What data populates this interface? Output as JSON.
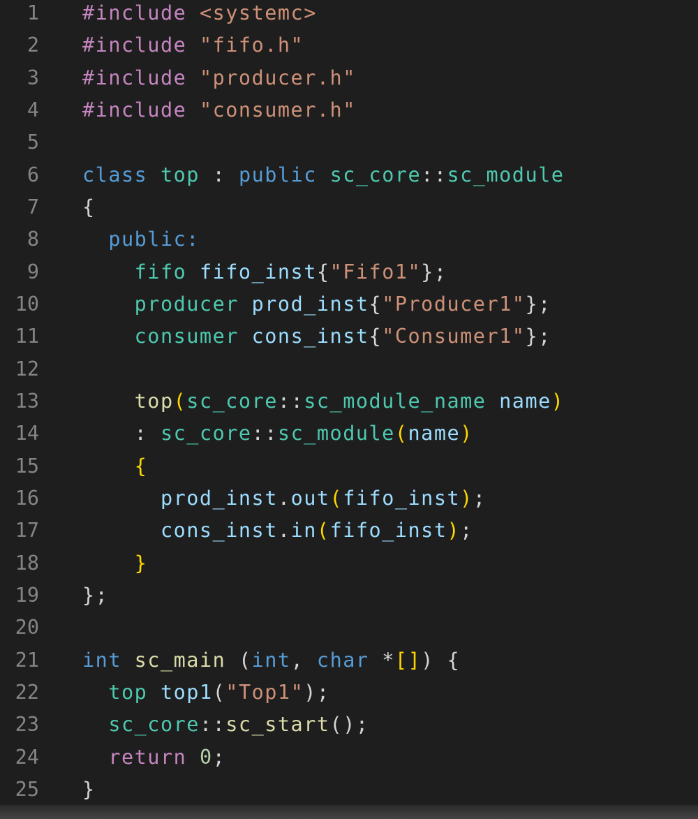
{
  "editor": {
    "language": "cpp",
    "lines": [
      {
        "n": "1",
        "tokens": [
          {
            "t": "#include",
            "c": "kwc"
          },
          {
            "t": " "
          },
          {
            "t": "<systemc>",
            "c": "str"
          }
        ]
      },
      {
        "n": "2",
        "tokens": [
          {
            "t": "#include",
            "c": "kwc"
          },
          {
            "t": " "
          },
          {
            "t": "\"fifo.h\"",
            "c": "str"
          }
        ]
      },
      {
        "n": "3",
        "tokens": [
          {
            "t": "#include",
            "c": "kwc"
          },
          {
            "t": " "
          },
          {
            "t": "\"producer.h\"",
            "c": "str"
          }
        ]
      },
      {
        "n": "4",
        "tokens": [
          {
            "t": "#include",
            "c": "kwc"
          },
          {
            "t": " "
          },
          {
            "t": "\"consumer.h\"",
            "c": "str"
          }
        ]
      },
      {
        "n": "5",
        "tokens": []
      },
      {
        "n": "6",
        "tokens": [
          {
            "t": "class",
            "c": "kw"
          },
          {
            "t": " "
          },
          {
            "t": "top",
            "c": "type"
          },
          {
            "t": " : ",
            "c": "punc"
          },
          {
            "t": "public",
            "c": "kw"
          },
          {
            "t": " "
          },
          {
            "t": "sc_core",
            "c": "type"
          },
          {
            "t": "::",
            "c": "punc"
          },
          {
            "t": "sc_module",
            "c": "type"
          }
        ]
      },
      {
        "n": "7",
        "tokens": [
          {
            "t": "{",
            "c": "punc"
          }
        ]
      },
      {
        "n": "8",
        "tokens": [
          {
            "t": "  "
          },
          {
            "t": "public",
            "c": "kw"
          },
          {
            "t": ":",
            "c": "kw"
          }
        ]
      },
      {
        "n": "9",
        "tokens": [
          {
            "t": "    "
          },
          {
            "t": "fifo",
            "c": "type"
          },
          {
            "t": " "
          },
          {
            "t": "fifo_inst",
            "c": "var"
          },
          {
            "t": "{",
            "c": "punc"
          },
          {
            "t": "\"Fifo1\"",
            "c": "str"
          },
          {
            "t": "};",
            "c": "punc"
          }
        ]
      },
      {
        "n": "10",
        "tokens": [
          {
            "t": "    "
          },
          {
            "t": "producer",
            "c": "type"
          },
          {
            "t": " "
          },
          {
            "t": "prod_inst",
            "c": "var"
          },
          {
            "t": "{",
            "c": "punc"
          },
          {
            "t": "\"Producer1\"",
            "c": "str"
          },
          {
            "t": "};",
            "c": "punc"
          }
        ]
      },
      {
        "n": "11",
        "tokens": [
          {
            "t": "    "
          },
          {
            "t": "consumer",
            "c": "type"
          },
          {
            "t": " "
          },
          {
            "t": "cons_inst",
            "c": "var"
          },
          {
            "t": "{",
            "c": "punc"
          },
          {
            "t": "\"Consumer1\"",
            "c": "str"
          },
          {
            "t": "};",
            "c": "punc"
          }
        ]
      },
      {
        "n": "12",
        "tokens": []
      },
      {
        "n": "13",
        "tokens": [
          {
            "t": "    "
          },
          {
            "t": "top",
            "c": "fn"
          },
          {
            "t": "(",
            "c": "br1"
          },
          {
            "t": "sc_core",
            "c": "type"
          },
          {
            "t": "::",
            "c": "punc"
          },
          {
            "t": "sc_module_name",
            "c": "type"
          },
          {
            "t": " "
          },
          {
            "t": "name",
            "c": "var"
          },
          {
            "t": ")",
            "c": "br1"
          }
        ]
      },
      {
        "n": "14",
        "tokens": [
          {
            "t": "    "
          },
          {
            "t": ": ",
            "c": "punc"
          },
          {
            "t": "sc_core",
            "c": "type"
          },
          {
            "t": "::",
            "c": "punc"
          },
          {
            "t": "sc_module",
            "c": "type"
          },
          {
            "t": "(",
            "c": "br1"
          },
          {
            "t": "name",
            "c": "var"
          },
          {
            "t": ")",
            "c": "br1"
          }
        ]
      },
      {
        "n": "15",
        "tokens": [
          {
            "t": "    "
          },
          {
            "t": "{",
            "c": "br1"
          }
        ]
      },
      {
        "n": "16",
        "tokens": [
          {
            "t": "      "
          },
          {
            "t": "prod_inst",
            "c": "var"
          },
          {
            "t": ".",
            "c": "punc"
          },
          {
            "t": "out",
            "c": "var"
          },
          {
            "t": "(",
            "c": "br1"
          },
          {
            "t": "fifo_inst",
            "c": "var"
          },
          {
            "t": ")",
            "c": "br1"
          },
          {
            "t": ";",
            "c": "punc"
          }
        ]
      },
      {
        "n": "17",
        "tokens": [
          {
            "t": "      "
          },
          {
            "t": "cons_inst",
            "c": "var"
          },
          {
            "t": ".",
            "c": "punc"
          },
          {
            "t": "in",
            "c": "var"
          },
          {
            "t": "(",
            "c": "br1"
          },
          {
            "t": "fifo_inst",
            "c": "var"
          },
          {
            "t": ")",
            "c": "br1"
          },
          {
            "t": ";",
            "c": "punc"
          }
        ]
      },
      {
        "n": "18",
        "tokens": [
          {
            "t": "    "
          },
          {
            "t": "}",
            "c": "br1"
          }
        ]
      },
      {
        "n": "19",
        "tokens": [
          {
            "t": "};",
            "c": "punc"
          }
        ]
      },
      {
        "n": "20",
        "tokens": []
      },
      {
        "n": "21",
        "tokens": [
          {
            "t": "int",
            "c": "kw"
          },
          {
            "t": " "
          },
          {
            "t": "sc_main",
            "c": "fn"
          },
          {
            "t": " "
          },
          {
            "t": "(",
            "c": "punc"
          },
          {
            "t": "int",
            "c": "kw"
          },
          {
            "t": ", ",
            "c": "punc"
          },
          {
            "t": "char",
            "c": "kw"
          },
          {
            "t": " "
          },
          {
            "t": "*",
            "c": "punc"
          },
          {
            "t": "[]",
            "c": "br1"
          },
          {
            "t": ") {",
            "c": "punc"
          }
        ]
      },
      {
        "n": "22",
        "tokens": [
          {
            "t": "  "
          },
          {
            "t": "top",
            "c": "type"
          },
          {
            "t": " "
          },
          {
            "t": "top1",
            "c": "var"
          },
          {
            "t": "(",
            "c": "punc"
          },
          {
            "t": "\"Top1\"",
            "c": "str"
          },
          {
            "t": ");",
            "c": "punc"
          }
        ]
      },
      {
        "n": "23",
        "tokens": [
          {
            "t": "  "
          },
          {
            "t": "sc_core",
            "c": "type"
          },
          {
            "t": "::",
            "c": "punc"
          },
          {
            "t": "sc_start",
            "c": "fn"
          },
          {
            "t": "();",
            "c": "punc"
          }
        ]
      },
      {
        "n": "24",
        "tokens": [
          {
            "t": "  "
          },
          {
            "t": "return",
            "c": "kwc"
          },
          {
            "t": " "
          },
          {
            "t": "0",
            "c": "num"
          },
          {
            "t": ";",
            "c": "punc"
          }
        ]
      },
      {
        "n": "25",
        "tokens": [
          {
            "t": "}",
            "c": "punc"
          }
        ]
      }
    ]
  },
  "colors": {
    "background": "#1e1e1e",
    "line_number": "#858585",
    "keyword_control": "#c586c0",
    "string": "#ce9178",
    "keyword": "#569cd6",
    "type": "#4ec9b0",
    "variable": "#9cdcfe",
    "function": "#dcdcaa",
    "number": "#b5cea8"
  }
}
